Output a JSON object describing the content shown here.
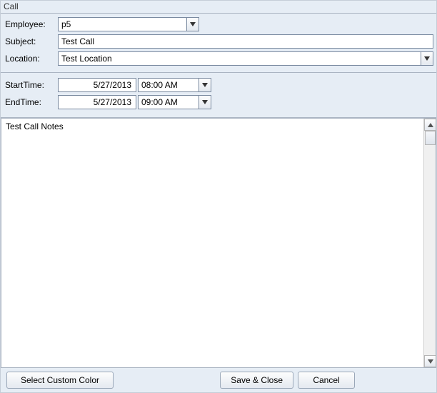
{
  "window": {
    "title": "Call"
  },
  "form": {
    "employee_label": "Employee:",
    "employee_value": "p5",
    "subject_label": "Subject:",
    "subject_value": "Test Call",
    "location_label": "Location:",
    "location_value": "Test Location"
  },
  "time": {
    "start_label": "StartTime:",
    "start_date": "5/27/2013",
    "start_time": "08:00 AM",
    "end_label": "EndTime:",
    "end_date": "5/27/2013",
    "end_time": "09:00 AM"
  },
  "notes": {
    "value": "Test Call Notes"
  },
  "buttons": {
    "select_color": "Select Custom Color",
    "save_close": "Save & Close",
    "cancel": "Cancel"
  }
}
